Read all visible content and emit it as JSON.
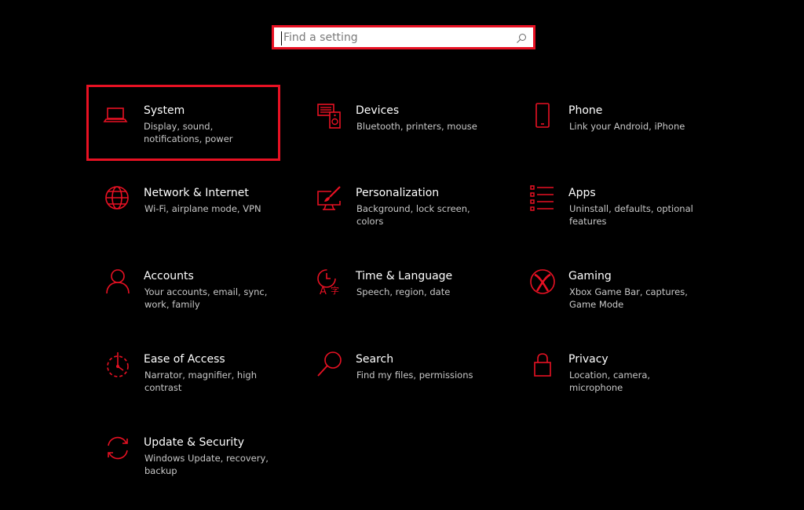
{
  "search": {
    "placeholder": "Find a setting",
    "icon": "search-icon"
  },
  "accent_color": "#e81123",
  "tiles": [
    {
      "title": "System",
      "desc": "Display, sound, notifications, power",
      "icon": "laptop-icon"
    },
    {
      "title": "Devices",
      "desc": "Bluetooth, printers, mouse",
      "icon": "devices-icon"
    },
    {
      "title": "Phone",
      "desc": "Link your Android, iPhone",
      "icon": "phone-icon"
    },
    {
      "title": "Network & Internet",
      "desc": "Wi-Fi, airplane mode, VPN",
      "icon": "globe-icon"
    },
    {
      "title": "Personalization",
      "desc": "Background, lock screen, colors",
      "icon": "paintbrush-icon"
    },
    {
      "title": "Apps",
      "desc": "Uninstall, defaults, optional features",
      "icon": "apps-list-icon"
    },
    {
      "title": "Accounts",
      "desc": "Your accounts, email, sync, work, family",
      "icon": "person-icon"
    },
    {
      "title": "Time & Language",
      "desc": "Speech, region, date",
      "icon": "time-language-icon"
    },
    {
      "title": "Gaming",
      "desc": "Xbox Game Bar, captures, Game Mode",
      "icon": "xbox-icon"
    },
    {
      "title": "Ease of Access",
      "desc": "Narrator, magnifier, high contrast",
      "icon": "ease-of-access-icon"
    },
    {
      "title": "Search",
      "desc": "Find my files, permissions",
      "icon": "magnifier-icon"
    },
    {
      "title": "Privacy",
      "desc": "Location, camera, microphone",
      "icon": "lock-icon"
    },
    {
      "title": "Update & Security",
      "desc": "Windows Update, recovery, backup",
      "icon": "sync-icon"
    }
  ]
}
